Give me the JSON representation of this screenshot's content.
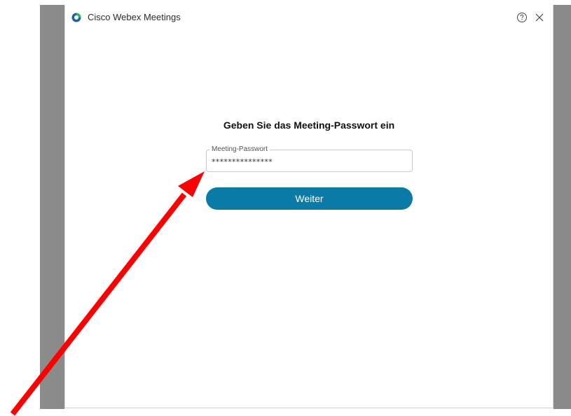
{
  "window": {
    "title": "Cisco Webex Meetings",
    "icons": {
      "app_logo": "webex-logo-icon",
      "help": "help-circle-icon",
      "close": "close-icon"
    }
  },
  "dialog": {
    "heading": "Geben Sie das Meeting-Passwort ein",
    "password_field": {
      "label": "Meeting-Passwort",
      "value": "***************"
    },
    "continue_button": {
      "label": "Weiter"
    }
  },
  "annotation": {
    "arrow_color": "#ff0000"
  },
  "colors": {
    "accent": "#0a7ba6",
    "background_side": "#8a8a8a"
  }
}
